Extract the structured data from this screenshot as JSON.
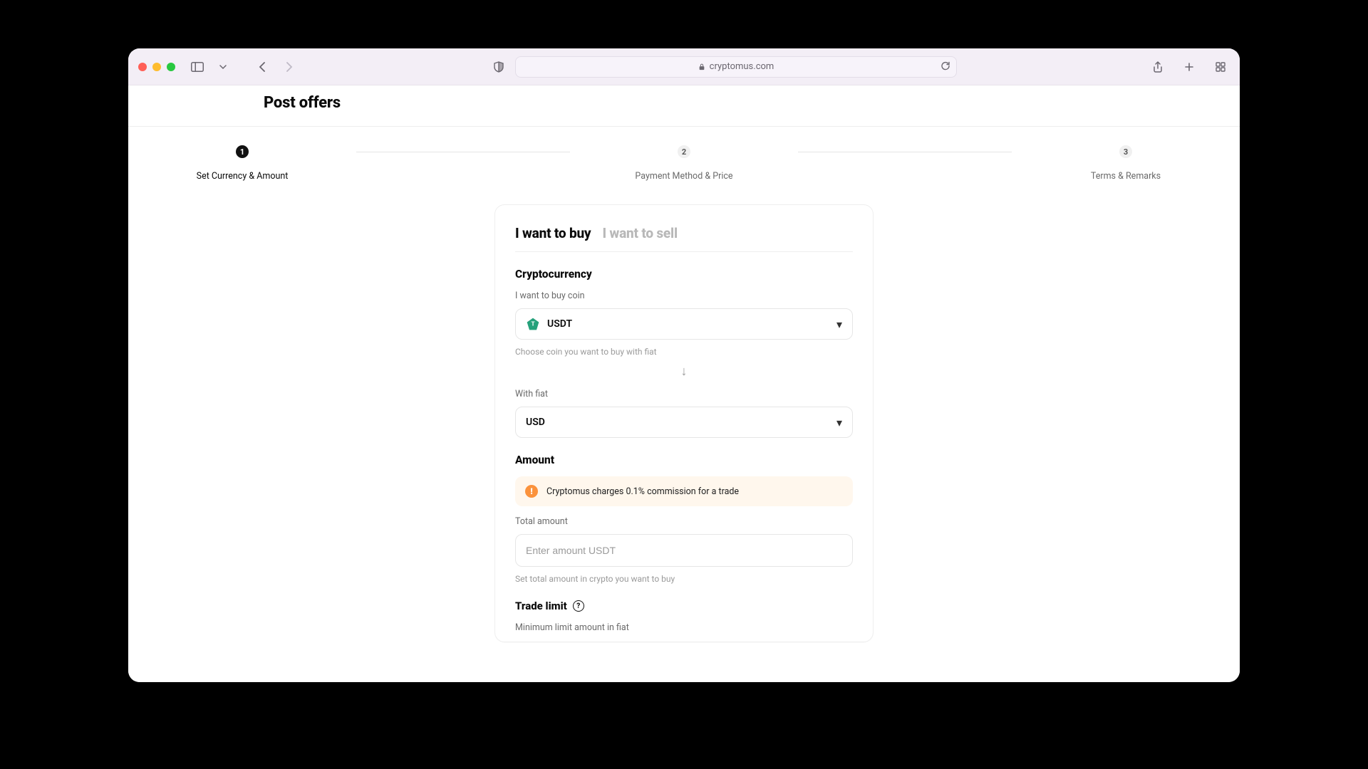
{
  "browser": {
    "url_host": "cryptomus.com"
  },
  "header": {
    "title": "Post offers"
  },
  "stepper": {
    "steps": [
      {
        "num": "1",
        "label": "Set Currency & Amount",
        "active": true
      },
      {
        "num": "2",
        "label": "Payment Method & Price",
        "active": false
      },
      {
        "num": "3",
        "label": "Terms & Remarks",
        "active": false
      }
    ]
  },
  "tabs": {
    "buy": "I want to buy",
    "sell": "I want to sell"
  },
  "crypto": {
    "section_title": "Cryptocurrency",
    "coin_label": "I want to buy coin",
    "coin_value": "USDT",
    "coin_helper": "Choose coin you want to buy with fiat",
    "fiat_label": "With fiat",
    "fiat_value": "USD"
  },
  "amount": {
    "section_title": "Amount",
    "notice": "Cryptomus charges 0.1% commission for a trade",
    "total_label": "Total amount",
    "total_placeholder": "Enter amount USDT",
    "total_helper": "Set total amount in crypto you want to buy"
  },
  "trade_limit": {
    "title": "Trade limit",
    "min_label": "Minimum limit amount in fiat"
  }
}
